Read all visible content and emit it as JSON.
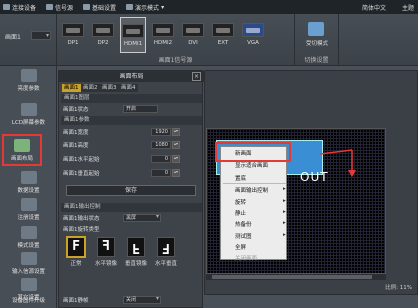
{
  "topbar": {
    "items": [
      "连接设备",
      "信号源",
      "基础设置",
      "演示模式"
    ],
    "language": "简体中文",
    "theme": "主题"
  },
  "ribbon": {
    "screen_label": "画面1",
    "sources": [
      "DP1",
      "DP2",
      "HDMI1",
      "HDMI2",
      "DVI",
      "EXT",
      "VGA"
    ],
    "selected_source": "HDMI1",
    "group_source_label": "画面1信号源",
    "switch_mode_label": "受切模式",
    "group_switch_label": "切换设置"
  },
  "leftnav": {
    "items": [
      "亮度参数",
      "LCD屏幕参数",
      "画面布局",
      "数据设置",
      "注册设置",
      "模式设置",
      "输入信源设置",
      "其它设置",
      "设备固件升级"
    ],
    "selected": "画面布局"
  },
  "panel": {
    "title": "画面布局",
    "tabs": [
      "画面1",
      "画面2",
      "画面3",
      "画面4"
    ],
    "sec_layer": "画面1图层",
    "state_label": "画面1状态",
    "state_value": "开启",
    "sec_params": "画面1参数",
    "width_label": "画面1宽度",
    "width_value": "1920",
    "height_label": "画面1高度",
    "height_value": "1080",
    "hstart_label": "画面1水平起始",
    "hstart_value": "0",
    "vstart_label": "画面1垂直起始",
    "vstart_value": "0",
    "save": "保存",
    "sec_output": "画面1输出控制",
    "outstate_label": "画面1输出状态",
    "outstate_value": "黑屏",
    "rotate_label": "画面1旋转类型",
    "rotate_glyph": "F",
    "rotations": [
      "正常",
      "水平镜像",
      "垂直镜像",
      "水平垂直"
    ],
    "selected_rotation": "正常",
    "mute_label": "画面1静帧",
    "mute_value": "关闭"
  },
  "canvas": {
    "out_label": "OUT",
    "scale_text": "比例: 11%"
  },
  "context_menu": {
    "items": [
      "新画面",
      "显示适合画面",
      "置底",
      "画面输出控制",
      "旋转",
      "静止",
      "热备份",
      "测试图",
      "全屏",
      "关闭画面"
    ],
    "highlighted": "新画面"
  }
}
